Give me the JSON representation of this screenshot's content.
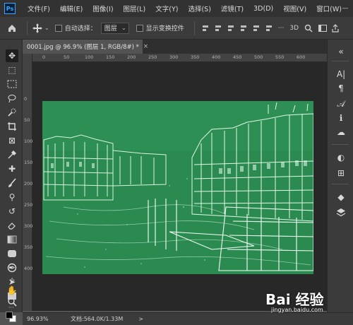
{
  "app": {
    "logo": "Ps"
  },
  "menu": [
    "文件(F)",
    "编辑(E)",
    "图像(I)",
    "图层(L)",
    "文字(Y)",
    "选择(S)",
    "滤镜(T)",
    "3D(D)",
    "视图(V)",
    "窗口(W)"
  ],
  "window_controls": {
    "minimize": "—",
    "close": "×"
  },
  "options": {
    "auto_select_label": "自动选择：",
    "auto_select_value": "图层",
    "show_transform_label": "显示变换控件"
  },
  "document": {
    "tab_title": "0001.jpg @ 96.9% (图层 1, RGB/8#) *",
    "close_glyph": "×"
  },
  "ruler": {
    "h_ticks": [
      "0",
      "50",
      "100",
      "150",
      "200",
      "250",
      "300",
      "350",
      "400",
      "450",
      "500",
      "550",
      "600"
    ],
    "v_ticks": [
      "0",
      "50",
      "100",
      "150",
      "200",
      "250",
      "300",
      "350",
      "400"
    ]
  },
  "status": {
    "zoom": "96.93%",
    "doc_info": "文档:564.0K/1.33M",
    "arrow": ">"
  },
  "watermark": {
    "logo": "Bai 经验",
    "url": "jingyan.baidu.com"
  },
  "colors": {
    "image_green": "#2b8a50",
    "edge_white": "#e9fff0"
  }
}
